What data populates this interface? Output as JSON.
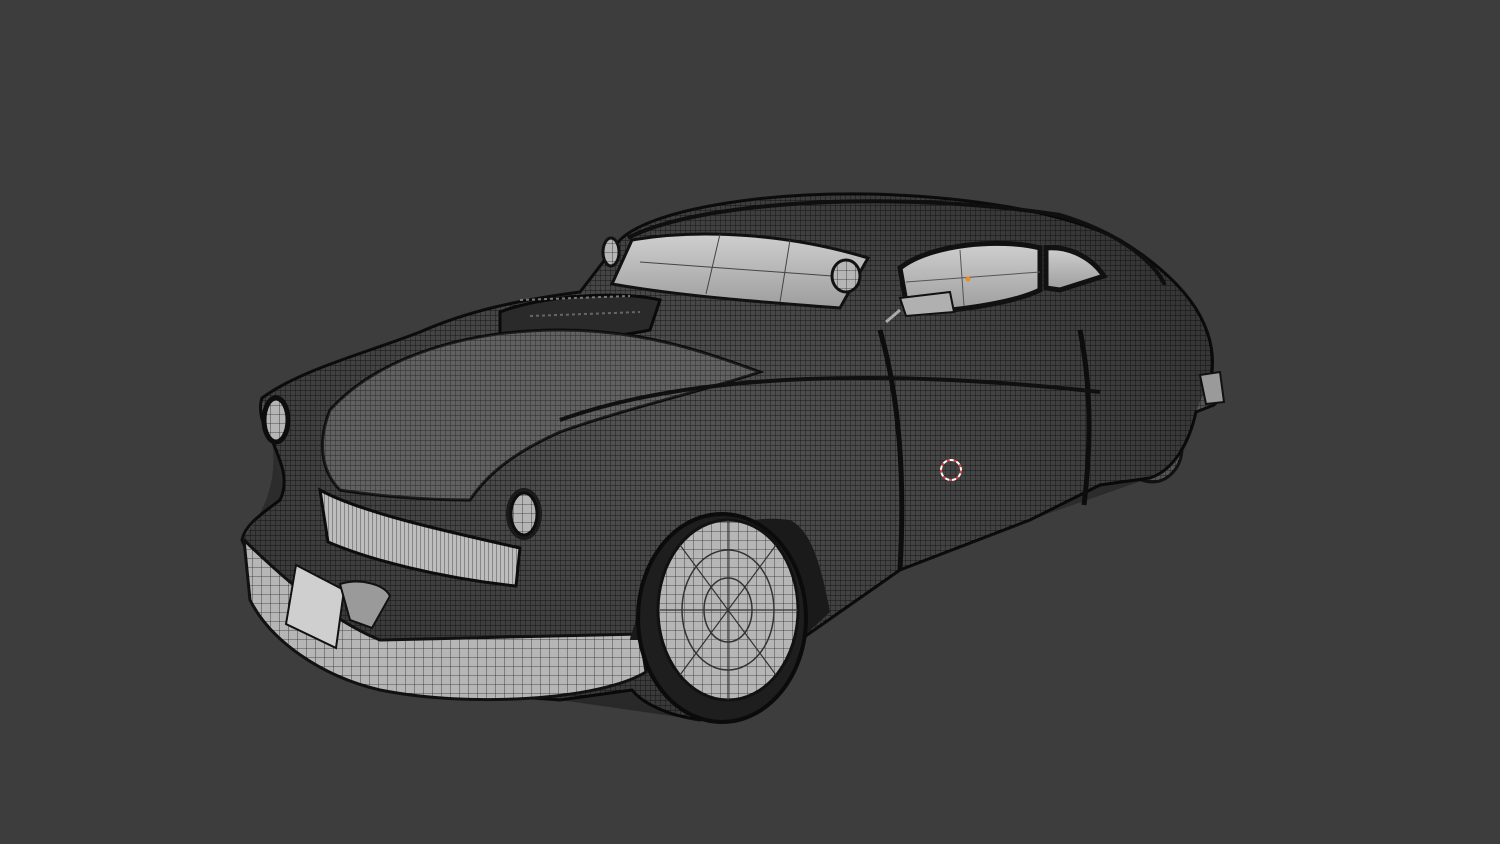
{
  "viewport": {
    "background_color": "#3d3d3d",
    "mode": "wireframe-overlay",
    "object": "car-mesh",
    "cursor_icon": "3d-cursor-icon",
    "origin_icon": "object-origin-icon"
  },
  "colors": {
    "body_dark": "#4a4a4a",
    "mesh_light": "#b8b8b8",
    "wire": "#141414",
    "cursor_red": "#e04040",
    "origin_orange": "#f08a24"
  }
}
